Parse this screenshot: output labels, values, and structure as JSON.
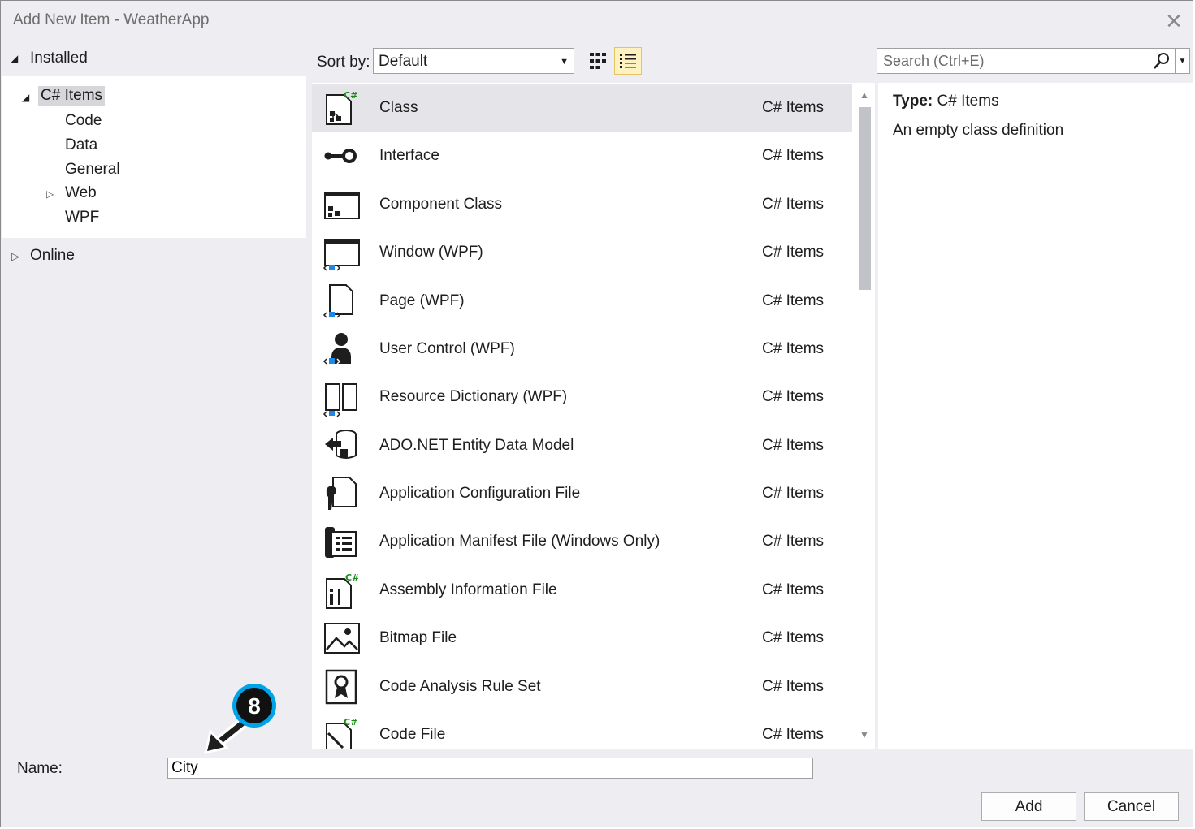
{
  "window": {
    "title": "Add New Item - WeatherApp",
    "close_glyph": "✕"
  },
  "tree": {
    "installed": "Installed",
    "items": [
      {
        "label": "C# Items",
        "selected": true
      },
      {
        "label": "Code"
      },
      {
        "label": "Data"
      },
      {
        "label": "General"
      },
      {
        "label": "Web",
        "collapsed": true
      },
      {
        "label": "WPF"
      }
    ],
    "online": "Online"
  },
  "toolbar": {
    "sort_label": "Sort by:",
    "sort_value": "Default",
    "search_placeholder": "Search (Ctrl+E)"
  },
  "templates": [
    {
      "name": "Class",
      "category": "C# Items",
      "icon": "class-icon",
      "selected": true
    },
    {
      "name": "Interface",
      "category": "C# Items",
      "icon": "interface-icon"
    },
    {
      "name": "Component Class",
      "category": "C# Items",
      "icon": "component-class-icon"
    },
    {
      "name": "Window (WPF)",
      "category": "C# Items",
      "icon": "wpf-window-icon"
    },
    {
      "name": "Page (WPF)",
      "category": "C# Items",
      "icon": "wpf-page-icon"
    },
    {
      "name": "User Control (WPF)",
      "category": "C# Items",
      "icon": "user-control-icon"
    },
    {
      "name": "Resource Dictionary (WPF)",
      "category": "C# Items",
      "icon": "resource-dictionary-icon"
    },
    {
      "name": "ADO.NET Entity Data Model",
      "category": "C# Items",
      "icon": "entity-data-model-icon"
    },
    {
      "name": "Application Configuration File",
      "category": "C# Items",
      "icon": "config-file-icon"
    },
    {
      "name": "Application Manifest File (Windows Only)",
      "category": "C# Items",
      "icon": "manifest-file-icon"
    },
    {
      "name": "Assembly Information File",
      "category": "C# Items",
      "icon": "assembly-info-icon"
    },
    {
      "name": "Bitmap File",
      "category": "C# Items",
      "icon": "bitmap-icon"
    },
    {
      "name": "Code Analysis Rule Set",
      "category": "C# Items",
      "icon": "rule-set-icon"
    },
    {
      "name": "Code File",
      "category": "C# Items",
      "icon": "code-file-icon"
    }
  ],
  "details": {
    "type_label": "Type:",
    "type_value": "C# Items",
    "description": "An empty class definition"
  },
  "form": {
    "name_label": "Name:",
    "name_value": "City",
    "add_button": "Add",
    "cancel_button": "Cancel"
  },
  "annotation": {
    "step_number": "8",
    "color": "#00a2e8"
  },
  "colors": {
    "csharp_green": "#1a8a1a",
    "wpf_blue": "#1e88e5",
    "selection": "#e5e5e9"
  }
}
